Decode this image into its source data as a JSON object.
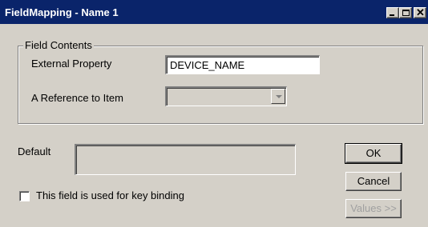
{
  "window": {
    "title": "FieldMapping - Name 1",
    "colors": {
      "titlebar": "#0a246a",
      "face": "#d4d0c8"
    }
  },
  "titlebar_buttons": {
    "minimize_icon": "minimize-icon",
    "maximize_icon": "maximize-icon",
    "close_icon": "close-icon"
  },
  "field_contents": {
    "group_label": "Field Contents",
    "external_property_label": "External Property",
    "external_property_value": "DEVICE_NAME",
    "reference_label": "A Reference to Item",
    "reference_value": ""
  },
  "default": {
    "label": "Default",
    "value": ""
  },
  "key_binding": {
    "label": "This field is used for key binding",
    "checked": false
  },
  "buttons": {
    "ok": "OK",
    "cancel": "Cancel",
    "values": "Values >>"
  }
}
